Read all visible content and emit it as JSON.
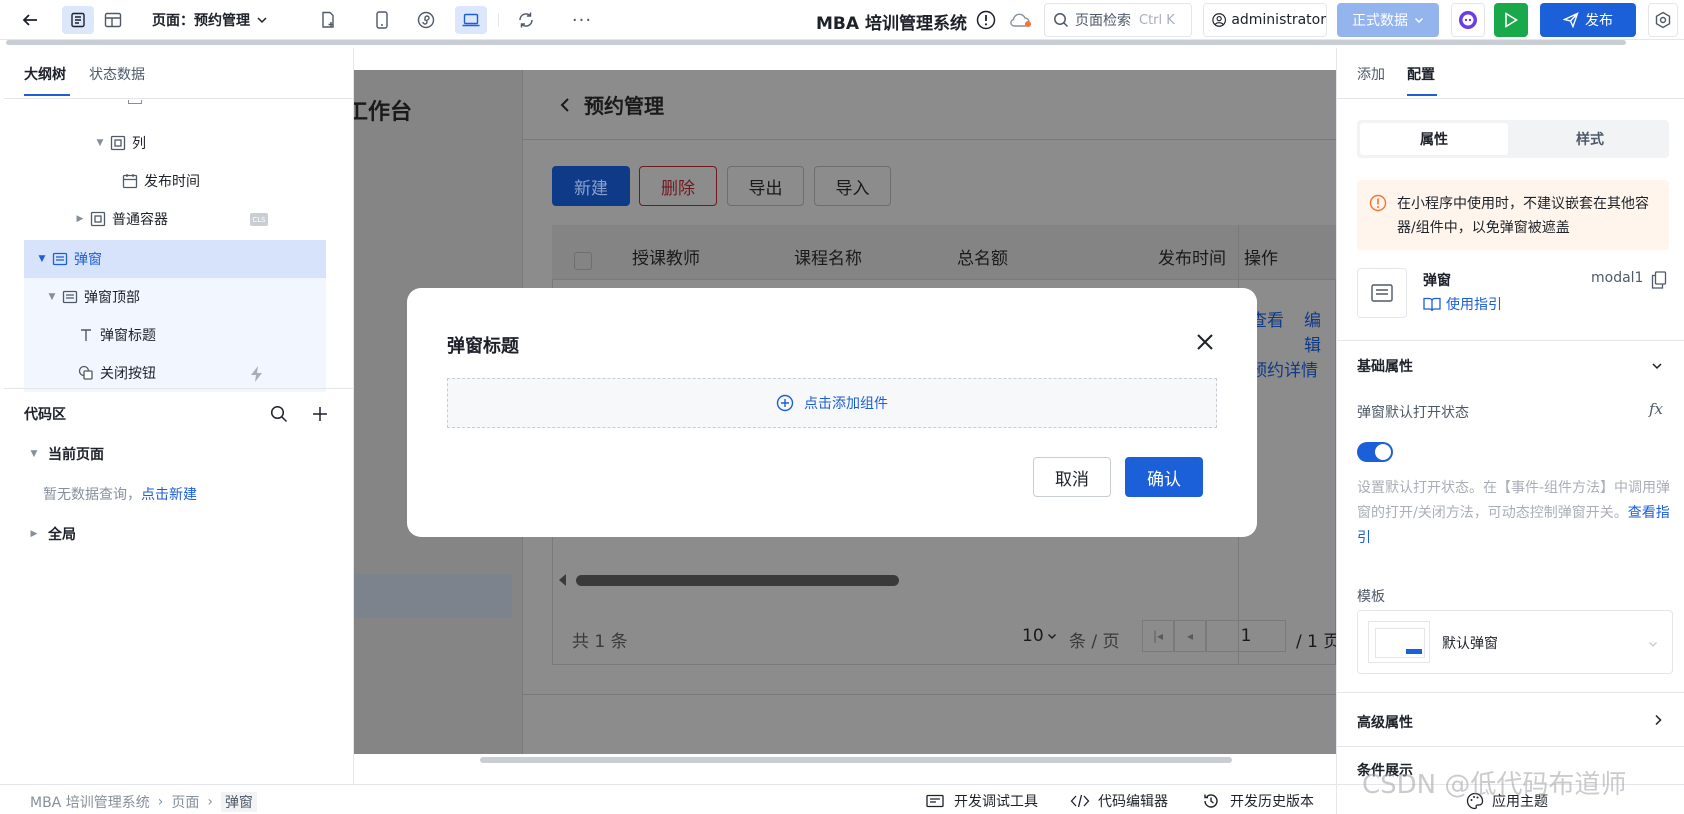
{
  "topbar": {
    "page_label": "页面：预约管理",
    "app_name": "MBA 培训管理系统",
    "search_placeholder": "页面检索",
    "search_shortcut": "Ctrl K",
    "user": "administrator",
    "env": "正式数据",
    "publish": "发布"
  },
  "left": {
    "tabs": [
      "大纲树",
      "状态数据"
    ],
    "tree": {
      "col": "列",
      "publish_time": "发布时间",
      "container": "普通容器",
      "container_badge": "CLS",
      "modal": "弹窗",
      "modal_header": "弹窗顶部",
      "modal_title": "弹窗标题",
      "close_btn": "关闭按钮"
    },
    "code": {
      "title": "代码区",
      "current_page": "当前页面",
      "empty_text": "暂无数据查询，",
      "create_link": "点击新建",
      "global": "全局"
    }
  },
  "canvas": {
    "workbench": "工作台",
    "page_title": "预约管理",
    "buttons": {
      "new": "新建",
      "delete": "删除",
      "export": "导出",
      "import": "导入"
    },
    "columns": [
      "授课教师",
      "课程名称",
      "总名额",
      "发布时间",
      "操作"
    ],
    "row_actions": {
      "view": "查看",
      "edit": "编辑",
      "detail": "预约详情"
    },
    "pager": {
      "total": "共 1 条",
      "size": "10",
      "per_page": "条 / 页",
      "page": "1",
      "of": "/ 1 页"
    }
  },
  "modal": {
    "title": "弹窗标题",
    "add_component": "点击添加组件",
    "cancel": "取消",
    "confirm": "确认"
  },
  "right": {
    "tabs": [
      "添加",
      "配置"
    ],
    "seg": [
      "属性",
      "样式"
    ],
    "warning": "在小程序中使用时，不建议嵌套在其他容器/组件中，以免弹窗被遮盖",
    "comp_name": "弹窗",
    "comp_id": "modal1",
    "guide": "使用指引",
    "basic": "基础属性",
    "open_state_label": "弹窗默认打开状态",
    "fx": "fx",
    "desc": "设置默认打开状态。在【事件-组件方法】中调用弹窗的打开/关闭方法，可动态控制弹窗开关。",
    "desc_link": "查看指引",
    "template_label": "模板",
    "template_value": "默认弹窗",
    "advanced": "高级属性",
    "condition": "条件展示"
  },
  "footer": {
    "breadcrumb": [
      "MBA 培训管理系统",
      "页面",
      "弹窗"
    ],
    "debug": "开发调试工具",
    "code_editor": "代码编辑器",
    "history": "开发历史版本",
    "theme": "应用主题",
    "watermark": "CSDN @低代码布道师"
  },
  "colors": {
    "primary": "#1b5fd9",
    "danger": "#d9363e",
    "run": "#1aa94a",
    "env": "#94b4ee"
  }
}
